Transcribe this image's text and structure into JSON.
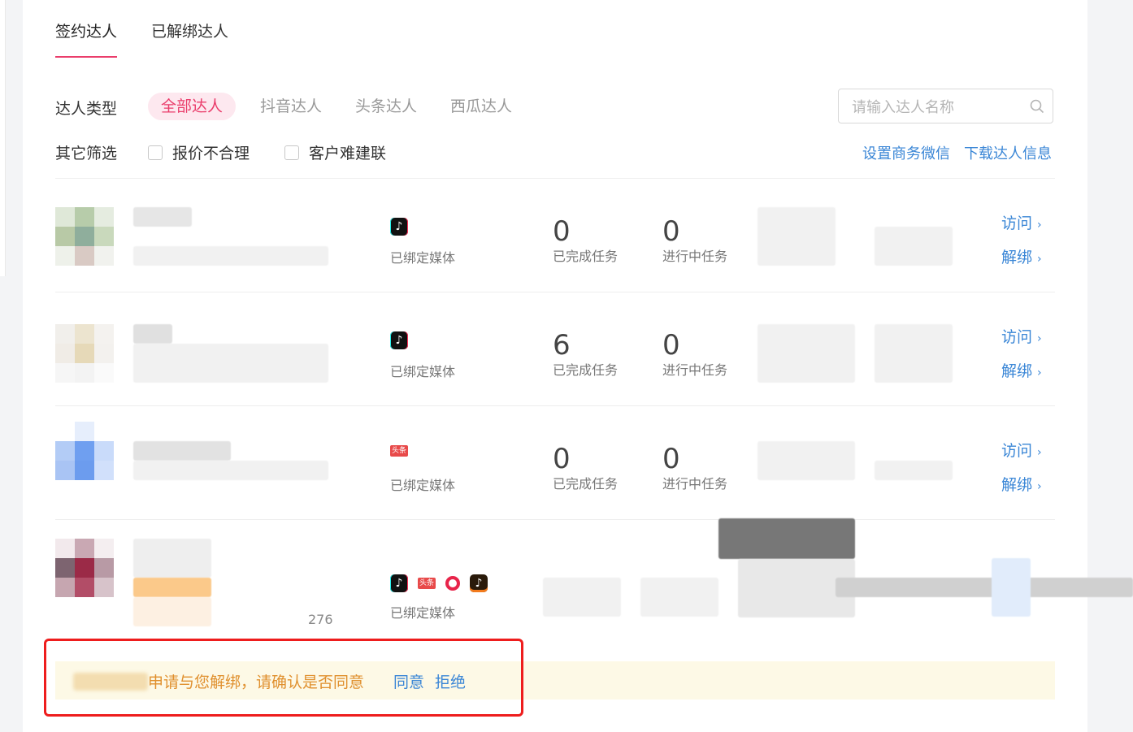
{
  "tabs": [
    {
      "label": "签约达人",
      "active": true
    },
    {
      "label": "已解绑达人",
      "active": false
    }
  ],
  "filters": {
    "type_label": "达人类型",
    "type_options": [
      "全部达人",
      "抖音达人",
      "头条达人",
      "西瓜达人"
    ],
    "type_selected": "全部达人",
    "other_label": "其它筛选",
    "checkboxes": [
      "报价不合理",
      "客户难建联"
    ],
    "search_placeholder": "请输入达人名称",
    "link_set_wechat": "设置商务微信",
    "link_download": "下载达人信息"
  },
  "talents": [
    {
      "media": [
        "douyin"
      ],
      "media_label": "已绑定媒体",
      "completed": "0",
      "completed_label": "已完成任务",
      "ongoing": "0",
      "ongoing_label": "进行中任务",
      "visit": "访问",
      "unbind": "解绑"
    },
    {
      "media": [
        "douyin"
      ],
      "media_label": "已绑定媒体",
      "completed": "6",
      "completed_label": "已完成任务",
      "ongoing": "0",
      "ongoing_label": "进行中任务",
      "visit": "访问",
      "unbind": "解绑"
    },
    {
      "media": [
        "toutiao"
      ],
      "media_label": "已绑定媒体",
      "completed": "0",
      "completed_label": "已完成任务",
      "ongoing": "0",
      "ongoing_label": "进行中任务",
      "visit": "访问",
      "unbind": "解绑"
    },
    {
      "media": [
        "douyin",
        "toutiao",
        "xigua",
        "douyin-huoshan"
      ],
      "media_label": "已绑定媒体",
      "id_fragment": "276"
    }
  ],
  "notice": {
    "text": "申请与您解绑，请确认是否同意",
    "agree": "同意",
    "reject": "拒绝"
  },
  "colors": {
    "accent": "#ea3d6b",
    "link": "#3a86d6",
    "notice_bg": "#fdf9e6",
    "notice_text": "#e0902e",
    "highlight_box": "#ee1d1d"
  },
  "icons": {
    "search": "search-icon",
    "douyin": "douyin-icon",
    "toutiao": "toutiao-icon",
    "xigua": "xigua-icon",
    "chevron": "chevron-right-icon"
  }
}
